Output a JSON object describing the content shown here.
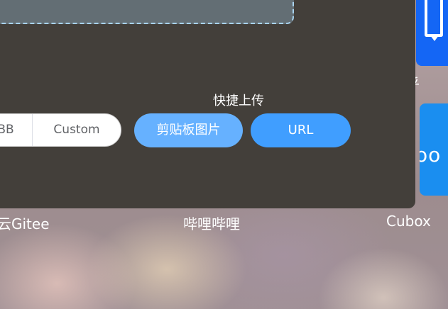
{
  "upload": {
    "quick_upload_title": "快捷上传",
    "tabs": [
      {
        "label": "BB"
      },
      {
        "label": "Custom"
      }
    ],
    "clipboard_button": "剪贴板图片",
    "url_button": "URL"
  },
  "right_tiles": {
    "zhihu_label": "乎",
    "cubox_tile_text": "oo"
  },
  "bottom_labels": {
    "gitee": "云Gitee",
    "bilibili": "哔哩哔哩",
    "cubox": "Cubox"
  },
  "colors": {
    "dialog_bg": "#433f3a",
    "primary": "#409eff",
    "primary_light": "#66b1ff",
    "dropzone_border": "#a9d3ee"
  }
}
